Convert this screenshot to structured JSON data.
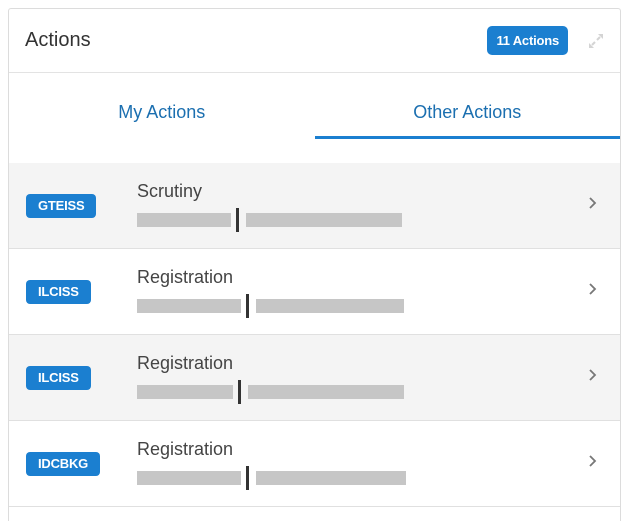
{
  "header": {
    "title": "Actions",
    "count_badge": "11 Actions",
    "expand_icon": "expand-icon"
  },
  "tabs": [
    {
      "label": "My Actions",
      "active": false
    },
    {
      "label": "Other Actions",
      "active": true
    }
  ],
  "actions": [
    {
      "tag": "GTEISS",
      "type": "Scrutiny"
    },
    {
      "tag": "ILCISS",
      "type": "Registration"
    },
    {
      "tag": "ILCISS",
      "type": "Registration"
    },
    {
      "tag": "IDCBKG",
      "type": "Registration"
    }
  ],
  "colors": {
    "accent": "#1b7fd0",
    "tab_text": "#1b6fb0",
    "row_alt_bg": "#f4f4f4"
  }
}
